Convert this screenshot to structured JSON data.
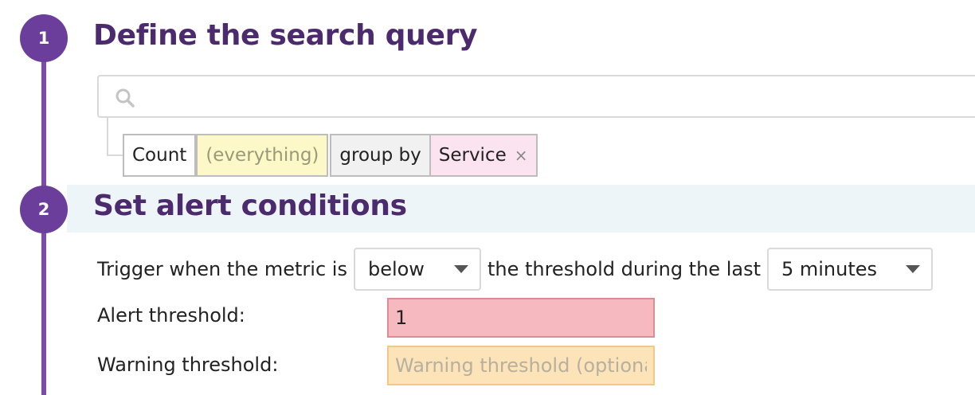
{
  "steps": [
    {
      "number": "1",
      "title": "Define the search query"
    },
    {
      "number": "2",
      "title": "Set alert conditions"
    }
  ],
  "search": {
    "value": "",
    "placeholder": ""
  },
  "query_chips": {
    "aggregation": "Count",
    "filter": "(everything)",
    "group_by_label": "group by",
    "group_by_value": "Service",
    "remove_glyph": "×"
  },
  "conditions": {
    "trigger_prefix": "Trigger when the metric is",
    "comparator": "below",
    "trigger_middle": "the threshold during the last",
    "time_window": "5 minutes",
    "alert_label": "Alert threshold:",
    "alert_value": "1",
    "warning_label": "Warning threshold:",
    "warning_value": "",
    "warning_placeholder": "Warning threshold (optional"
  },
  "colors": {
    "accent": "#6a3e9a",
    "title": "#4b2a6e",
    "alert_input_bg": "#f6b9c0",
    "warning_input_bg": "#fde3b8",
    "filter_chip_bg": "#fdf8c8",
    "service_chip_bg": "#fbe3f0"
  },
  "icons": {
    "search": "search-icon",
    "dropdown": "caret-down-icon",
    "remove": "close-icon"
  }
}
